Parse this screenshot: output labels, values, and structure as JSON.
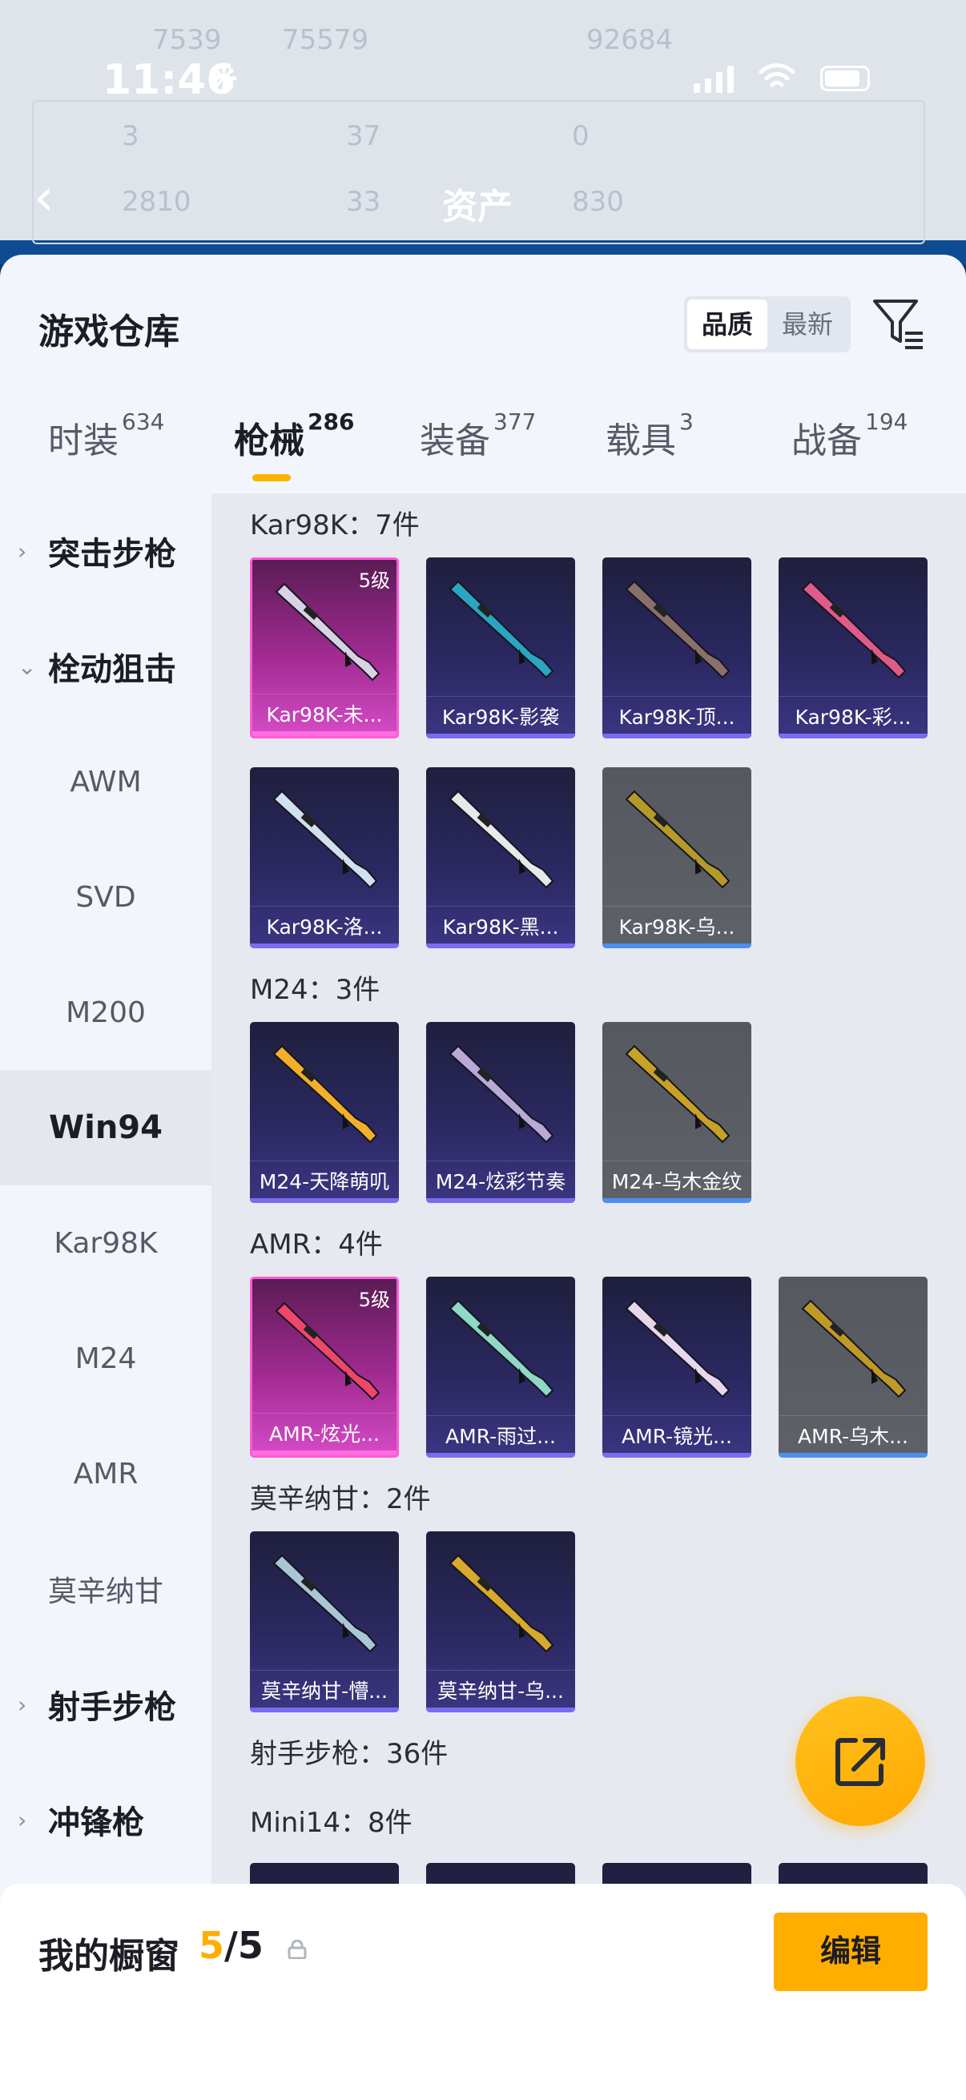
{
  "status_bar": {
    "time": "11:46"
  },
  "background_header": {
    "title": "资产",
    "stats_row1": [
      "7539",
      "75579",
      "92684"
    ],
    "stats_row2": [
      "3",
      "37",
      "0"
    ],
    "stats_row3": [
      "2810",
      "33",
      "830"
    ]
  },
  "sheet": {
    "title": "游戏仓库",
    "sort_options": [
      "品质",
      "最新"
    ],
    "active_sort": "品质"
  },
  "tabs": [
    {
      "label": "时装",
      "count": "634"
    },
    {
      "label": "枪械",
      "count": "286",
      "active": true
    },
    {
      "label": "装备",
      "count": "377"
    },
    {
      "label": "载具",
      "count": "3"
    },
    {
      "label": "战备",
      "count": "194"
    }
  ],
  "sidenav": [
    {
      "label": "突击步枪",
      "type": "group",
      "expanded": false
    },
    {
      "label": "栓动狙击",
      "type": "group",
      "expanded": true
    },
    {
      "label": "AWM",
      "type": "item"
    },
    {
      "label": "SVD",
      "type": "item"
    },
    {
      "label": "M200",
      "type": "item"
    },
    {
      "label": "Win94",
      "type": "item",
      "selected": true
    },
    {
      "label": "Kar98K",
      "type": "item"
    },
    {
      "label": "M24",
      "type": "item"
    },
    {
      "label": "AMR",
      "type": "item"
    },
    {
      "label": "莫辛纳甘",
      "type": "item"
    },
    {
      "label": "射手步枪",
      "type": "group",
      "expanded": false
    },
    {
      "label": "冲锋枪",
      "type": "group",
      "expanded": false
    }
  ],
  "sections": [
    {
      "title": "Kar98K：7件",
      "items": [
        {
          "name": "Kar98K-未...",
          "rarity": "legend",
          "level": "5级",
          "gun_color": "#d9d2e6"
        },
        {
          "name": "Kar98K-影袭",
          "rarity": "epic",
          "gun_color": "#2aa5c2"
        },
        {
          "name": "Kar98K-顶...",
          "rarity": "epic",
          "gun_color": "#8a6f6a"
        },
        {
          "name": "Kar98K-彩...",
          "rarity": "epic",
          "gun_color": "#e05a8a"
        },
        {
          "name": "Kar98K-洛...",
          "rarity": "epic",
          "gun_color": "#cfe0ee"
        },
        {
          "name": "Kar98K-黑...",
          "rarity": "epic",
          "gun_color": "#e8e8ea"
        },
        {
          "name": "Kar98K-乌...",
          "rarity": "rare",
          "gun_color": "#b59a28"
        }
      ]
    },
    {
      "title": "M24：3件",
      "items": [
        {
          "name": "M24-天降萌叽",
          "rarity": "epic",
          "gun_color": "#f2b02a"
        },
        {
          "name": "M24-炫彩节奏",
          "rarity": "epic",
          "gun_color": "#b8a9d8"
        },
        {
          "name": "M24-乌木金纹",
          "rarity": "rare",
          "gun_color": "#c8a224"
        }
      ]
    },
    {
      "title": "AMR：4件",
      "items": [
        {
          "name": "AMR-炫光...",
          "rarity": "legend",
          "level": "5级",
          "gun_color": "#f0466c"
        },
        {
          "name": "AMR-雨过...",
          "rarity": "epic",
          "gun_color": "#8fd8c8"
        },
        {
          "name": "AMR-镜光...",
          "rarity": "epic",
          "gun_color": "#e8d6ec"
        },
        {
          "name": "AMR-乌木...",
          "rarity": "rare",
          "gun_color": "#c09a26"
        }
      ]
    },
    {
      "title": "莫辛纳甘：2件",
      "items": [
        {
          "name": "莫辛纳甘-懵...",
          "rarity": "epic",
          "gun_color": "#a9c6d6"
        },
        {
          "name": "莫辛纳甘-乌...",
          "rarity": "epic",
          "gun_color": "#d7a92c"
        }
      ]
    }
  ],
  "category_heading": "射手步枪：36件",
  "next_section": {
    "title": "Mini14：8件"
  },
  "bottom_bar": {
    "label": "我的橱窗",
    "count_current": "5",
    "count_total": "/5",
    "edit_label": "编辑"
  },
  "colors": {
    "accent": "#ffae00",
    "legend": "#ff5ad6",
    "epic": "#7a6cf0",
    "rare": "#4c8ff0"
  }
}
